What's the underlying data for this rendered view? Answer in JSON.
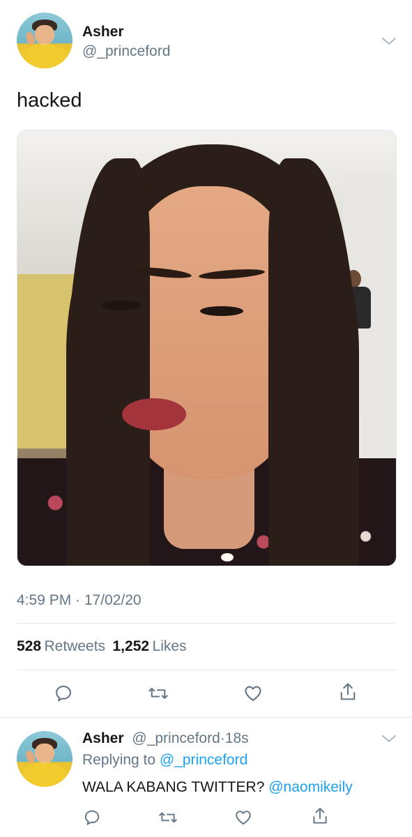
{
  "tweet": {
    "author_name": "Asher",
    "author_handle": "@_princeford",
    "text": "hacked",
    "timestamp": "4:59 PM · 17/02/20",
    "retweets_count": "528",
    "retweets_label": "Retweets",
    "likes_count": "1,252",
    "likes_label": "Likes"
  },
  "reply": {
    "author_name": "Asher",
    "author_handle": "@_princeford",
    "dot": "·",
    "age": "18s",
    "replying_prefix": "Replying to",
    "replying_to": "@_princeford",
    "text": "WALA KABANG TWITTER?",
    "mention": "@naomikeily"
  },
  "icons": {
    "reply": "reply-icon",
    "retweet": "retweet-icon",
    "like": "heart-icon",
    "share": "share-icon",
    "more": "chevron-down-icon"
  },
  "colors": {
    "text": "#14171a",
    "secondary": "#657786",
    "link": "#1da1f2",
    "divider": "#e1e8ed"
  }
}
